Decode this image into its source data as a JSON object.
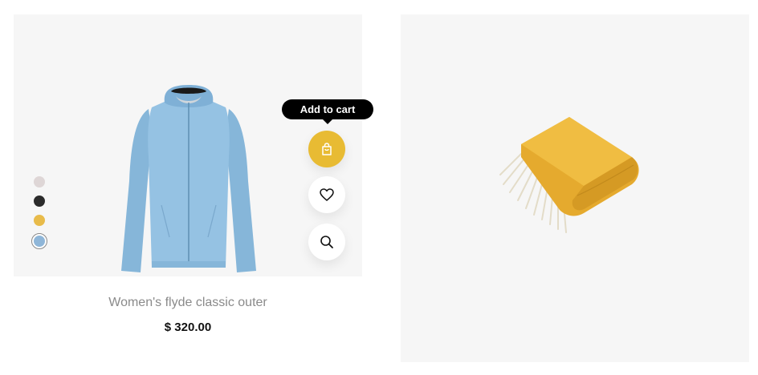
{
  "products": [
    {
      "title": "Women's flyde classic outer",
      "price": "$ 320.00",
      "image_icon": "light-blue-hooded-jacket",
      "swatches": [
        {
          "color": "#ded6d6",
          "selected": false
        },
        {
          "color": "#2b2b2b",
          "selected": false
        },
        {
          "color": "#e8bb4a",
          "selected": false
        },
        {
          "color": "#8fb6d8",
          "selected": true
        }
      ],
      "actions": {
        "tooltip": "Add to cart",
        "cart_icon": "shopping-bag-icon",
        "wishlist_icon": "heart-icon",
        "quickview_icon": "search-icon"
      }
    },
    {
      "image_icon": "folded-yellow-blanket"
    }
  ],
  "colors": {
    "accent": "#e8bb33",
    "card_bg": "#f6f6f6",
    "title_text": "#8a8a8a",
    "price_text": "#111111"
  }
}
